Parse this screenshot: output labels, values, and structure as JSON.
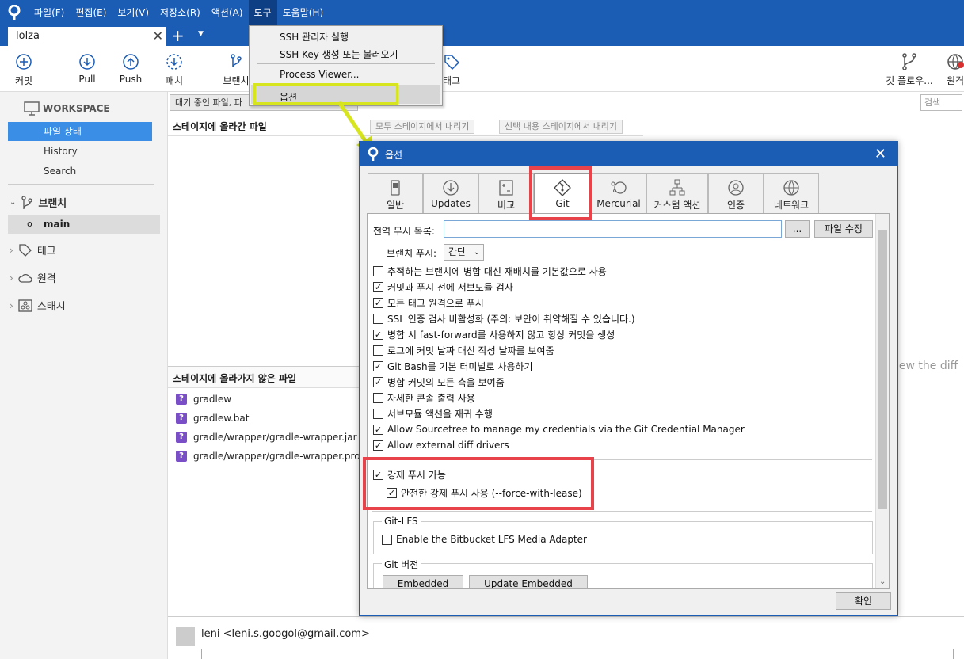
{
  "menubar": {
    "items": [
      "파일(F)",
      "편집(E)",
      "보기(V)",
      "저장소(R)",
      "액션(A)",
      "도구",
      "도움말(H)"
    ]
  },
  "tabbar": {
    "repo_tab": "lolza",
    "close": "✕",
    "add": "+",
    "dropdown": "▼"
  },
  "toolbar": {
    "commit": "커밋",
    "pull": "Pull",
    "push": "Push",
    "patch": "패치",
    "branch": "브랜치",
    "tag": "태그",
    "git_flow": "깃 플로우...",
    "remote": "원격"
  },
  "sidebar": {
    "workspace": "WORKSPACE",
    "file_status": "파일 상태",
    "history": "History",
    "search": "Search",
    "branches": "브랜치",
    "branch_main": "main",
    "tags": "태그",
    "remotes": "원격",
    "stashes": "스태시"
  },
  "main": {
    "filter": "대기 중인 파일, 파",
    "staged_header": "스테이지에 올라간 파일",
    "unstage_all": "모두 스테이지에서 내리기",
    "unstage_selected": "선택 내용 스테이지에서 내리기",
    "unstaged_header": "스테이지에 올라가지 않은 파일",
    "files": [
      "gradlew",
      "gradlew.bat",
      "gradle/wrapper/gradle-wrapper.jar",
      "gradle/wrapper/gradle-wrapper.propert"
    ],
    "search_placeholder": "검색",
    "diff_hint": "iew the diff"
  },
  "commit": {
    "user": "leni <leni.s.googol@gmail.com>"
  },
  "tools_menu": {
    "ssh_agent": "SSH 관리자 실행",
    "ssh_key": "SSH Key 생성 또는 불러오기",
    "process_viewer": "Process Viewer...",
    "options": "옵션"
  },
  "dialog": {
    "title": "옵션",
    "close": "✕",
    "tabs": [
      "일반",
      "Updates",
      "비교",
      "Git",
      "Mercurial",
      "커스텀 액션",
      "인증",
      "네트워크"
    ],
    "active_tab": "Git",
    "global_ignore_label": "전역 무시 목록:",
    "browse_btn": "...",
    "edit_file_btn": "파일 수정",
    "branch_push_label": "브랜치 푸시:",
    "branch_push_value": "간단",
    "options": [
      {
        "label": "추적하는 브랜치에 병합 대신 재배치를 기본값으로 사용",
        "checked": false
      },
      {
        "label": "커밋과 푸시 전에 서브모듈 검사",
        "checked": true
      },
      {
        "label": "모든 태그 원격으로 푸시",
        "checked": true
      },
      {
        "label": "SSL 인증 검사 비활성화 (주의: 보안이 취약해질 수 있습니다.)",
        "checked": false
      },
      {
        "label": "병합 시 fast-forward를 사용하지 않고 항상 커밋을 생성",
        "checked": true
      },
      {
        "label": "로그에 커밋 날짜 대신 작성 날짜를 보여줌",
        "checked": false
      },
      {
        "label": "Git Bash를 기본 터미널로 사용하기",
        "checked": true
      },
      {
        "label": "병합 커밋의 모든 측을 보여줌",
        "checked": true
      },
      {
        "label": "자세한 콘솔 출력 사용",
        "checked": false
      },
      {
        "label": "서브모듈 액션을 재귀 수행",
        "checked": false
      },
      {
        "label": "Allow Sourcetree to manage my credentials via the Git Credential Manager",
        "checked": true
      },
      {
        "label": "Allow external diff drivers",
        "checked": true
      }
    ],
    "force_push": {
      "label": "강제 푸시 가능",
      "checked": true
    },
    "force_with_lease": {
      "label": "안전한 강제 푸시 사용 (--force-with-lease)",
      "checked": true
    },
    "git_lfs_title": "Git-LFS",
    "lfs_option": {
      "label": "Enable the Bitbucket LFS Media Adapter",
      "checked": false
    },
    "git_version_title": "Git 버전",
    "embedded_btn": "Embedded",
    "update_embedded_btn": "Update Embedded",
    "ok_btn": "확인"
  },
  "colors": {
    "accent": "#1b5cb5",
    "highlight_red": "#e8434b",
    "highlight_yellow": "#d7e51e"
  }
}
